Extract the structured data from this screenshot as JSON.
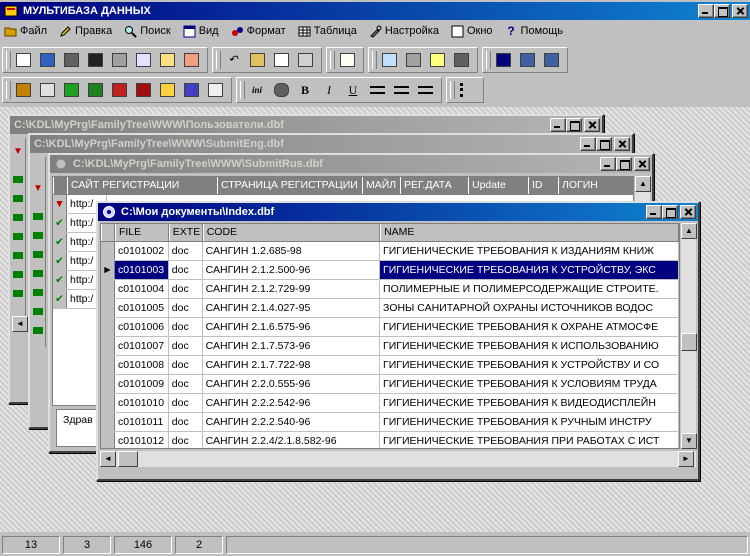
{
  "app": {
    "title": "МУЛЬТИБАЗА ДАННЫХ"
  },
  "menu": [
    {
      "label": "Файл",
      "icon": "folder-icon"
    },
    {
      "label": "Правка",
      "icon": "pencil-icon"
    },
    {
      "label": "Поиск",
      "icon": "magnifier-icon"
    },
    {
      "label": "Вид",
      "icon": "view-icon"
    },
    {
      "label": "Формат",
      "icon": "format-icon"
    },
    {
      "label": "Таблица",
      "icon": "table-icon"
    },
    {
      "label": "Настройка",
      "icon": "settings-icon"
    },
    {
      "label": "Окно",
      "icon": "window-icon"
    },
    {
      "label": "Помощь",
      "icon": "help-icon"
    }
  ],
  "toolbar": {
    "bold_label": "B",
    "italic_label": "I",
    "underline_label": "U",
    "ink_label": "ini"
  },
  "bg_windows": [
    {
      "title": "C:\\KDL\\MyPrg\\FamilyTree\\WWW\\Пользователи.dbf"
    },
    {
      "title": "C:\\KDL\\MyPrg\\FamilyTree\\WWW\\SubmitEng.dbf"
    },
    {
      "title": "C:\\KDL\\MyPrg\\FamilyTree\\WWW\\SubmitRus.dbf"
    }
  ],
  "submit_rus": {
    "columns": [
      "САЙТ РЕГИСТРАЦИИ",
      "СТРАНИЦА РЕГИСТРАЦИИ",
      "МАЙЛ",
      "РЕГ.ДАТА",
      "Update",
      "ID",
      "ЛОГИН"
    ],
    "cells": [
      "http:/",
      "http:/",
      "http:/",
      "http:/",
      "http:/",
      "http:/"
    ]
  },
  "bg_left_text": "Здрав",
  "index_window": {
    "title": "C:\\Мои документы\\Index.dbf",
    "columns": [
      "FILE",
      "EXTE",
      "CODE",
      "NAME"
    ],
    "rows": [
      {
        "file": "c0101002",
        "ext": "doc",
        "code": "САНГИН 1.2.685-98",
        "name": "ГИГИЕНИЧЕСКИЕ ТРЕБОВАНИЯ К ИЗДАНИЯМ КНИЖ"
      },
      {
        "file": "c0101003",
        "ext": "doc",
        "code": "САНГИН 2.1.2.500-96",
        "name": "ГИГИЕНИЧЕСКИЕ ТРЕБОВАНИЯ К УСТРОЙСТВУ, ЭКС",
        "selected": true
      },
      {
        "file": "c0101004",
        "ext": "doc",
        "code": "САНГИН 2.1.2.729-99",
        "name": "ПОЛИМЕРНЫЕ И ПОЛИМЕРСОДЕРЖАЩИЕ СТРОИТЕ."
      },
      {
        "file": "c0101005",
        "ext": "doc",
        "code": "САНГИН 2.1.4.027-95",
        "name": "ЗОНЫ САНИТАРНОЙ ОХРАНЫ ИСТОЧНИКОВ ВОДОС"
      },
      {
        "file": "c0101006",
        "ext": "doc",
        "code": "САНГИН 2.1.6.575-96",
        "name": "ГИГИЕНИЧЕСКИЕ ТРЕБОВАНИЯ К ОХРАНЕ АТМОСФЕ"
      },
      {
        "file": "c0101007",
        "ext": "doc",
        "code": "САНГИН 2.1.7.573-96",
        "name": "ГИГИЕНИЧЕСКИЕ ТРЕБОВАНИЯ К ИСПОЛЬЗОВАНИЮ"
      },
      {
        "file": "c0101008",
        "ext": "doc",
        "code": "САНГИН 2.1.7.722-98",
        "name": "ГИГИЕНИЧЕСКИЕ ТРЕБОВАНИЯ К УСТРОЙСТВУ И СО"
      },
      {
        "file": "c0101009",
        "ext": "doc",
        "code": "САНГИН 2.2.0.555-96",
        "name": "ГИГИЕНИЧЕСКИЕ ТРЕБОВАНИЯ К УСЛОВИЯМ ТРУДА"
      },
      {
        "file": "c0101010",
        "ext": "doc",
        "code": "САНГИН 2.2.2.542-96",
        "name": "ГИГИЕНИЧЕСКИЕ ТРЕБОВАНИЯ К ВИДЕОДИСПЛЕЙН"
      },
      {
        "file": "c0101011",
        "ext": "doc",
        "code": "САНГИН 2.2.2.540-96",
        "name": "ГИГИЕНИЧЕСКИЕ ТРЕБОВАНИЯ К РУЧНЫМ ИНСТРУ"
      },
      {
        "file": "c0101012",
        "ext": "doc",
        "code": "САНГИН 2.2.4/2.1.8.582-96",
        "name": "ГИГИЕНИЧЕСКИЕ ТРЕБОВАНИЯ ПРИ РАБОТАХ С ИСТ"
      }
    ]
  },
  "status": [
    "13",
    "3",
    "146",
    "2"
  ],
  "colors": {
    "active_title": "#000080",
    "selection": "#000080",
    "face": "#c0c0c0"
  }
}
